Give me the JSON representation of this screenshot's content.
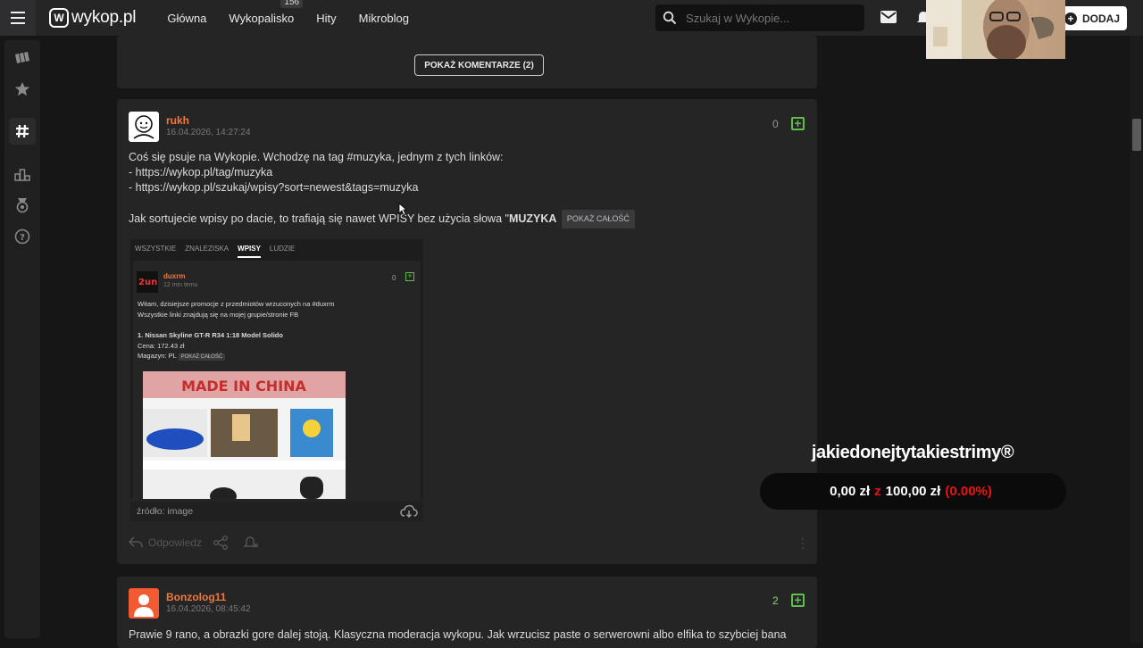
{
  "topbar": {
    "logo_text": "wykop.pl",
    "nav": [
      {
        "label": "Główna"
      },
      {
        "label": "Wykopalisko",
        "count": "156"
      },
      {
        "label": "Hity"
      },
      {
        "label": "Mikroblog"
      }
    ],
    "search_placeholder": "Szukaj w Wykopie...",
    "add_label": "DODAJ"
  },
  "sidebar": {
    "items": [
      {
        "icon": "wykop-icon"
      },
      {
        "icon": "star-icon"
      },
      {
        "icon": "hashtag-icon",
        "active": true
      },
      {
        "icon": "ranking-icon"
      },
      {
        "icon": "medal-icon"
      },
      {
        "icon": "help-icon"
      }
    ]
  },
  "prev_post": {
    "show_comments_label": "POKAŻ KOMENTARZE (2)"
  },
  "post1": {
    "author": "rukh",
    "date": "16.04.2026, 14:27:24",
    "votes": "0",
    "line1": "Coś się psuje na Wykopie. Wchodzę na tag #muzyka, jednym z tych linków:",
    "line2": "- https://wykop.pl/tag/muzyka",
    "line3": "- https://wykop.pl/szukaj/wpisy?sort=newest&tags=muzyka",
    "line4": "Jak sortujecie wpisy po dacie, to trafiają się nawet WPISY bez użycia słowa \"",
    "line4_bold": "MUZYKA",
    "show_all": "POKAŻ CAŁOŚĆ",
    "embed": {
      "tabs": [
        "WSZYSTKIE",
        "ZNALEZISKA",
        "WPISY",
        "LUDZIE"
      ],
      "active_tab": "WPISY",
      "author": "duxrm",
      "time": "12 min temu",
      "votes": "0",
      "text1": "Witam, dzisiejsze promocje z przedmiotów wrzuconych na #duxrm",
      "text2": "Wszystkie linki znajdują się na mojej grupie/stronie FB",
      "text3": "1. Nissan Skyline GT-R R34 1:18 Model Solido",
      "text4": "Cena: 172.43 zł",
      "text5": "Magazyn: PL",
      "show_all": "POKAŻ CAŁOŚĆ",
      "banner": "MADE IN CHINA"
    },
    "source": "źródło: image",
    "reply": "Odpowiedz"
  },
  "post2": {
    "author": "Bonzolog11",
    "date": "16.04.2026, 08:45:42",
    "votes": "2",
    "text": "Prawie 9 rano, a obrazki gore dalej stoją. Klasyczna moderacja wykopu. Jak wrzucisz paste o serwerowni albo elfika to szybciej bana"
  },
  "overlay": {
    "title": "jakiedonejtytakiestrimy®",
    "amount": "0,00 zł",
    "sep": "z",
    "goal": "100,00 zł",
    "percent": "(0.00%)"
  },
  "colors": {
    "accent": "#f07a3c",
    "plus_green": "#5fbf4a",
    "overlay_red": "#e11111"
  }
}
